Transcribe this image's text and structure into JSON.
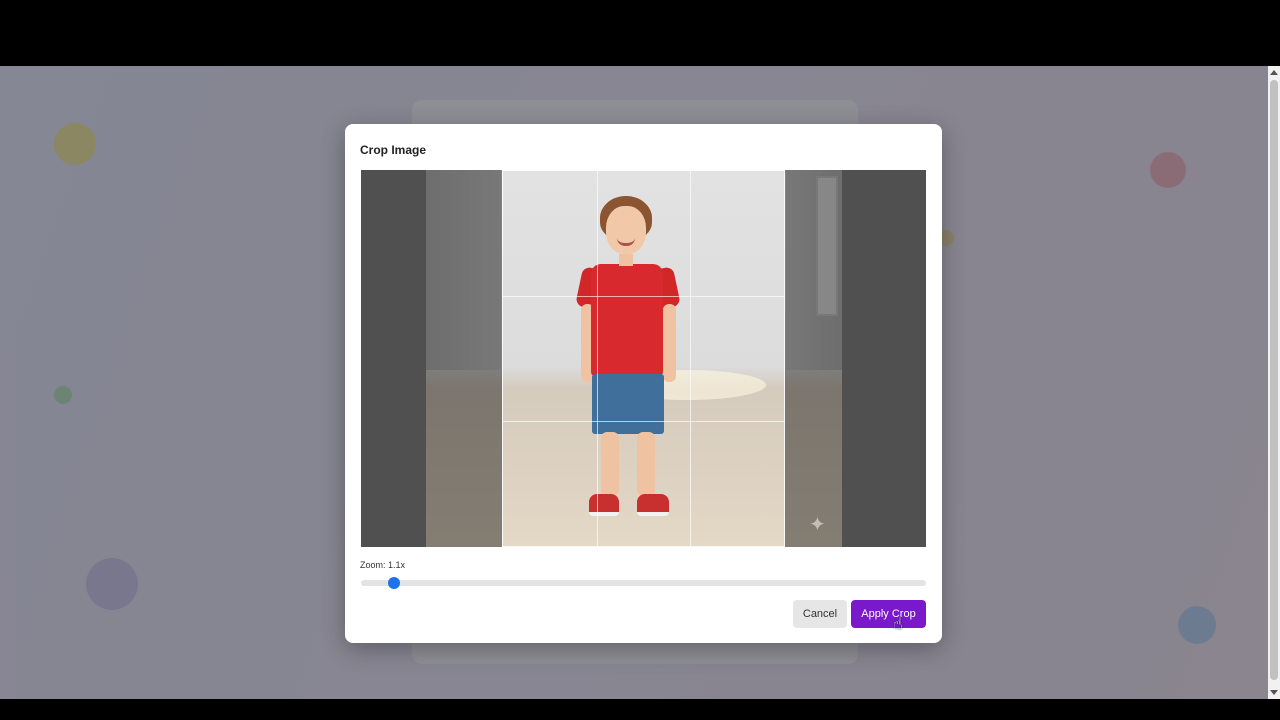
{
  "modal": {
    "title": "Crop Image",
    "zoom_label": "Zoom: 1.1x",
    "zoom_value": 1.1,
    "zoom_fraction": 0.058,
    "cancel_label": "Cancel",
    "apply_label": "Apply Crop"
  },
  "colors": {
    "apply_button": "#7a18cc",
    "slider_thumb": "#1a73e8",
    "overlay": "rgba(72,72,84,0.62)"
  },
  "icons": {
    "cursor": "hand-pointer-icon",
    "sparkle": "sparkle-icon"
  }
}
